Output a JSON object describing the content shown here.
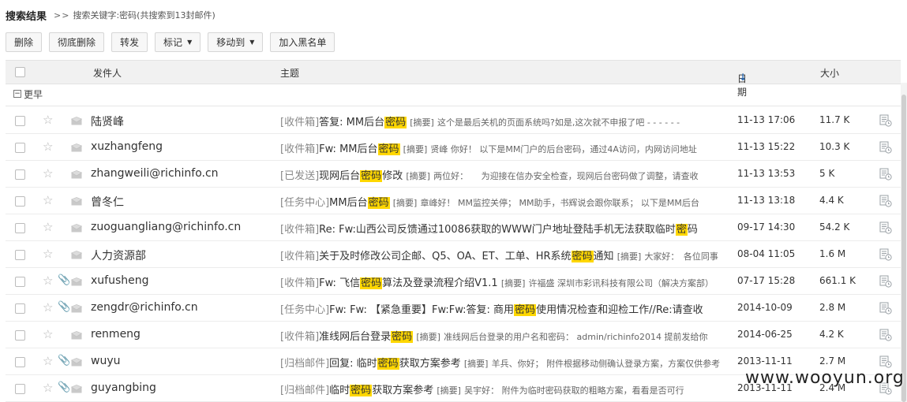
{
  "breadcrumb": {
    "title": "搜索结果",
    "arrows": ">>",
    "keyword_text": "搜索关键字:密码(共搜索到13封邮件)"
  },
  "toolbar": {
    "delete": "删除",
    "perm_delete": "彻底删除",
    "forward": "转发",
    "mark": "标记",
    "move": "移动到",
    "blacklist": "加入黑名单"
  },
  "header": {
    "sender": "发件人",
    "subject": "主题",
    "date": "日期",
    "sort_arrow": "↓",
    "size": "大小"
  },
  "group": {
    "label": "更早",
    "toggle": "−"
  },
  "emails": [
    {
      "sender": "陆贤峰",
      "folder": "[收件箱]",
      "pre": "答复: MM后台",
      "hl": "密码",
      "post": "",
      "ab": "[摘要]",
      "preview": "这个是最后关机的页面系统吗?如是,这次就不申报了吧 - - - - - -",
      "date": "11-13 17:06",
      "size": "11.7 K",
      "attach": false
    },
    {
      "sender": "xuzhangfeng",
      "folder": "[收件箱]",
      "pre": "Fw: MM后台",
      "hl": "密码",
      "post": "",
      "ab": "[摘要]",
      "preview": "贤峰 你好！ 以下是MM门户的后台密码，通过4A访问，内网访问地址",
      "date": "11-13 15:22",
      "size": "10.3 K",
      "attach": false
    },
    {
      "sender": "zhangweili@richinfo.cn",
      "folder": "[已发送]",
      "pre": "现网后台",
      "hl": "密码",
      "post": "修改",
      "ab": "[摘要]",
      "preview": "两位好：　　为迎接在信办安全检查，现网后台密码做了调整，请查收",
      "date": "11-13 13:53",
      "size": "5 K",
      "attach": false
    },
    {
      "sender": "曾冬仁",
      "folder": "[任务中心]",
      "pre": "MM后台",
      "hl": "密码",
      "post": "",
      "ab": "[摘要]",
      "preview": "章峰好！ MM监控关停； MM助手，书辉说会跟你联系； 以下是MM后台",
      "date": "11-13 13:18",
      "size": "4.4 K",
      "attach": false
    },
    {
      "sender": "zuoguangliang@richinfo.cn",
      "folder": "[收件箱]",
      "pre": "Re: Fw:山西公司反馈通过10086获取的WWW门户地址登陆手机无法获取临时",
      "hl": "密",
      "post": "码",
      "ab": "",
      "preview": "",
      "date": "09-17 14:30",
      "size": "54.2 K",
      "attach": false
    },
    {
      "sender": "人力资源部",
      "folder": "[收件箱]",
      "pre": "关于及时修改公司企邮、Q5、OA、ET、工单、HR系统",
      "hl": "密码",
      "post": "通知",
      "ab": "[摘要]",
      "preview": "大家好：　各位同事",
      "date": "08-04 11:05",
      "size": "1.6 M",
      "attach": false
    },
    {
      "sender": "xufusheng",
      "folder": "[收件箱]",
      "pre": "Fw: 飞信",
      "hl": "密码",
      "post": "算法及登录流程介绍V1.1",
      "ab": "[摘要]",
      "preview": "许福盛 深圳市彩讯科技有限公司（解决方案部）",
      "date": "07-17 15:28",
      "size": "661.1 K",
      "attach": true
    },
    {
      "sender": "zengdr@richinfo.cn",
      "folder": "[任务中心]",
      "pre": "Fw: Fw: 【紧急重要】Fw:Fw:答复: 商用",
      "hl": "密码",
      "post": "使用情况检查和迎检工作//Re:请查收",
      "ab": "",
      "preview": "",
      "date": "2014-10-09",
      "size": "2.8 M",
      "attach": true
    },
    {
      "sender": "renmeng",
      "folder": "[收件箱]",
      "pre": "准线网后台登录",
      "hl": "密码",
      "post": "",
      "ab": "[摘要]",
      "preview": "准线网后台登录的用户名和密码： admin/richinfo2014 提前发给你",
      "date": "2014-06-25",
      "size": "4.2 K",
      "attach": false
    },
    {
      "sender": "wuyu",
      "folder": "[归档邮件]",
      "pre": "回复: 临时",
      "hl": "密码",
      "post": "获取方案参考",
      "ab": "[摘要]",
      "preview": "羊兵、你好； 附件根据移动侧确认登录方案，方案仅供参考",
      "date": "2013-11-11",
      "size": "2.7 M",
      "attach": true
    },
    {
      "sender": "guyangbing",
      "folder": "[归档邮件]",
      "pre": "临时",
      "hl": "密码",
      "post": "获取方案参考",
      "ab": "[摘要]",
      "preview": "吴宇好： 附件为临时密码获取的粗略方案，看看是否可行",
      "date": "2013-11-11",
      "size": "2.4 M",
      "attach": true
    }
  ],
  "watermark": "www.wooyun.org",
  "colors": {
    "highlight": "#ffd700",
    "folder": "#888888",
    "header_bg": "#f1f1f1",
    "sort_arrow": "#2a6bb5"
  }
}
